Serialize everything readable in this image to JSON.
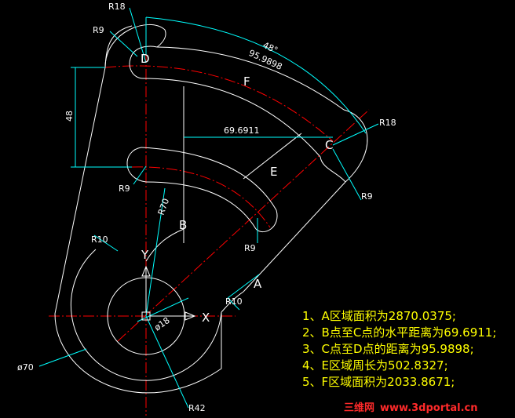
{
  "colors": {
    "background": "#000000",
    "outline": "#ffffff",
    "centerline": "#ff0000",
    "dimension": "#00ffff",
    "note": "#ffff00",
    "watermark": "#ff2a2a"
  },
  "radius_labels": {
    "r18_top": "R18",
    "r9_top": "R9",
    "r18_right": "R18",
    "r9_right": "R9",
    "r9_left": "R9",
    "r9_mid": "R9",
    "r10_left": "R10",
    "r10_right": "R10",
    "r70": "R70",
    "r42": "R42"
  },
  "dimensions": {
    "angle": "48°",
    "arc_length": "95.9898",
    "vertical": "48",
    "horizontal": "69.6911",
    "dia_small": "ø18",
    "dia_large": "ø70"
  },
  "point_labels": {
    "d": "D",
    "c": "C",
    "b": "B",
    "a": "A",
    "e": "E",
    "f": "F"
  },
  "axes": {
    "x": "X",
    "y": "Y"
  },
  "notes": [
    "1、A区域面积为2870.0375;",
    "2、B点至C点的水平距离为69.6911;",
    "3、C点至D点的距离为95.9898;",
    "4、E区域周长为502.8327;",
    "5、F区域面积为2033.8671;"
  ],
  "watermark": {
    "brand": "三维网",
    "url": "www.3dportal.cn"
  }
}
